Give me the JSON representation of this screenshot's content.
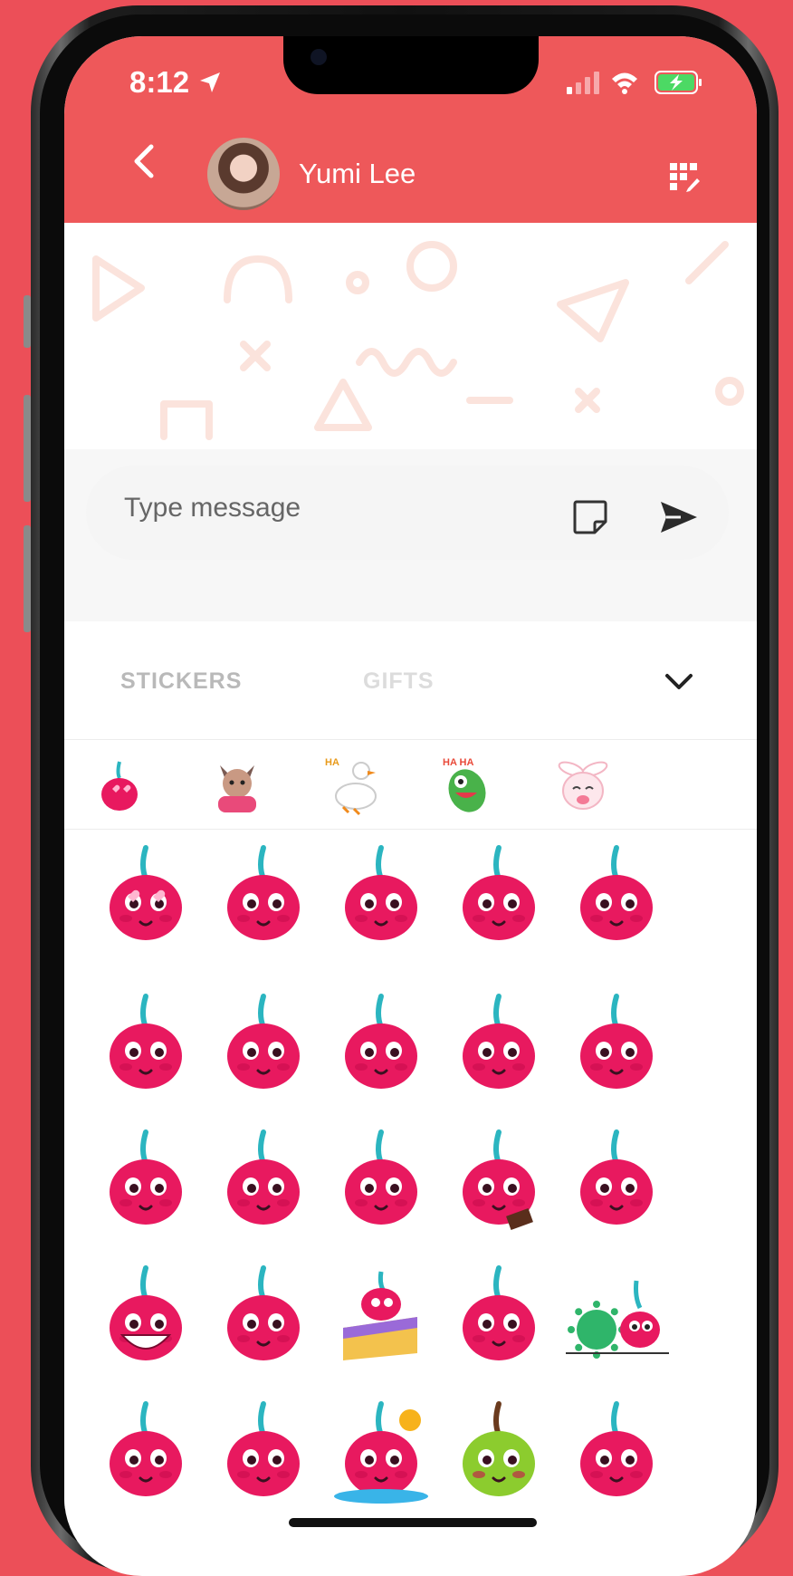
{
  "status_bar": {
    "time": "8:12"
  },
  "header": {
    "contact_name": "Yumi Lee"
  },
  "composer": {
    "placeholder": "Type message"
  },
  "tabs": [
    {
      "label": "STICKERS"
    },
    {
      "label": "GIFTS"
    }
  ],
  "sticker_packs": [
    "cherry",
    "cat",
    "duck",
    "green-creature",
    "bunny"
  ],
  "stickers": [
    [
      "heart-eyes",
      "dashing",
      "blushing",
      "dancing",
      "nooo-squashed"
    ],
    [
      "kissing",
      "sweating",
      "thumbs-up",
      "hugging",
      "sleeping"
    ],
    [
      "pleading",
      "whistling",
      "shocked",
      "eating-chocolate",
      "unamused"
    ],
    [
      "big-grin",
      "cheeky",
      "cake",
      "crying",
      "virus"
    ],
    [
      "smiling",
      "confused",
      "melting",
      "green-pear",
      "sad"
    ]
  ],
  "colors": {
    "background": "#EC4F58",
    "header": "#EE585A",
    "cherry": "#E8195F",
    "stem": "#2BB5C0"
  }
}
